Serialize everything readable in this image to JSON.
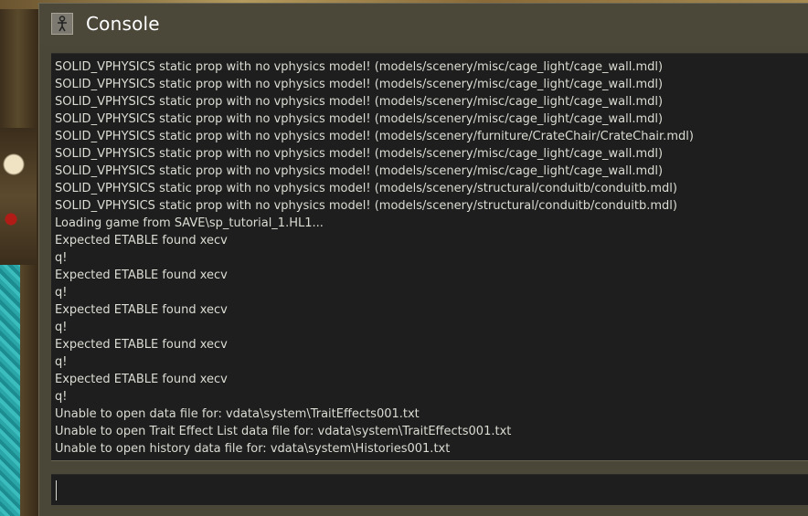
{
  "window": {
    "title": "Console",
    "icon": "hl-lambda-person-icon"
  },
  "log": {
    "lines": [
      "SOLID_VPHYSICS static prop with no vphysics model! (models/scenery/misc/cage_light/cage_wall.mdl)",
      "SOLID_VPHYSICS static prop with no vphysics model! (models/scenery/misc/cage_light/cage_wall.mdl)",
      "SOLID_VPHYSICS static prop with no vphysics model! (models/scenery/misc/cage_light/cage_wall.mdl)",
      "SOLID_VPHYSICS static prop with no vphysics model! (models/scenery/misc/cage_light/cage_wall.mdl)",
      "SOLID_VPHYSICS static prop with no vphysics model! (models/scenery/furniture/CrateChair/CrateChair.mdl)",
      "SOLID_VPHYSICS static prop with no vphysics model! (models/scenery/misc/cage_light/cage_wall.mdl)",
      "SOLID_VPHYSICS static prop with no vphysics model! (models/scenery/misc/cage_light/cage_wall.mdl)",
      "SOLID_VPHYSICS static prop with no vphysics model! (models/scenery/structural/conduitb/conduitb.mdl)",
      "SOLID_VPHYSICS static prop with no vphysics model! (models/scenery/structural/conduitb/conduitb.mdl)",
      "Loading game from SAVE\\sp_tutorial_1.HL1...",
      "Expected ETABLE found xecv",
      "q!",
      "Expected ETABLE found xecv",
      "q!",
      "Expected ETABLE found xecv",
      "q!",
      "Expected ETABLE found xecv",
      "q!",
      "Expected ETABLE found xecv",
      "q!",
      "Unable to open data file for: vdata\\system\\TraitEffects001.txt",
      "Unable to open Trait Effect List data file for: vdata\\system\\TraitEffects001.txt",
      "Unable to open history data file for: vdata\\system\\Histories001.txt"
    ]
  },
  "input": {
    "value": "",
    "placeholder": ""
  },
  "colors": {
    "window_bg": "#4a4638",
    "log_bg": "#1e1e1e",
    "text": "#dcdcd4"
  }
}
